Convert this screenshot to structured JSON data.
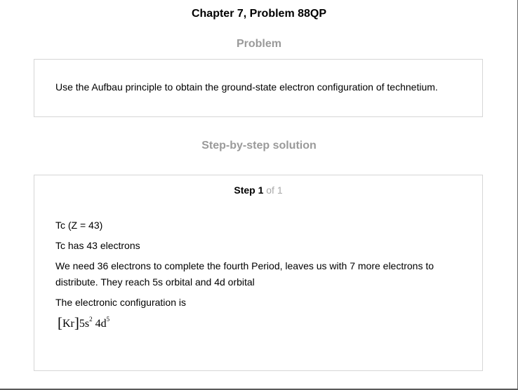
{
  "page": {
    "title": "Chapter 7, Problem 88QP"
  },
  "problem": {
    "heading": "Problem",
    "text": "Use the Aufbau principle to obtain the ground-state electron configuration of technetium."
  },
  "solution": {
    "heading": "Step-by-step solution",
    "step": {
      "label": "Step 1",
      "of": " of 1"
    },
    "lines": [
      "Tc (Z = 43)",
      "Tc has 43 electrons",
      "We need 36 electrons to complete the fourth Period, leaves us with 7 more electrons to distribute. They reach 5s orbital and 4d orbital",
      "The electronic configuration is"
    ],
    "formula": {
      "open_bracket": "[",
      "core": "Kr",
      "close_bracket": "]",
      "orbital_1": "5s",
      "exp_1": "2",
      "orbital_2": "4d",
      "exp_2": "5"
    }
  }
}
